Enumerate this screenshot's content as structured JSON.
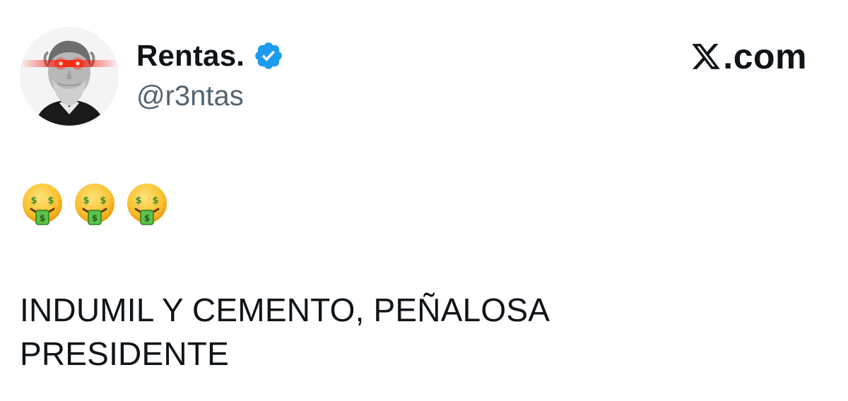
{
  "author": {
    "display_name": "Rentas.",
    "handle": "@r3ntas",
    "verified": true,
    "verified_color": "#1d9bf0"
  },
  "site": {
    "logo_icon": "x-logo-icon",
    "suffix": ".com"
  },
  "tweet": {
    "emojis": [
      "money-mouth-face-icon",
      "money-mouth-face-icon",
      "money-mouth-face-icon"
    ],
    "text_lines": [
      "INDUMIL Y CEMENTO, PEÑALOSA",
      "PRESIDENTE"
    ]
  },
  "colors": {
    "text": "#0f1419",
    "secondary": "#536471",
    "laser_eyes": "#ff2a1a"
  }
}
